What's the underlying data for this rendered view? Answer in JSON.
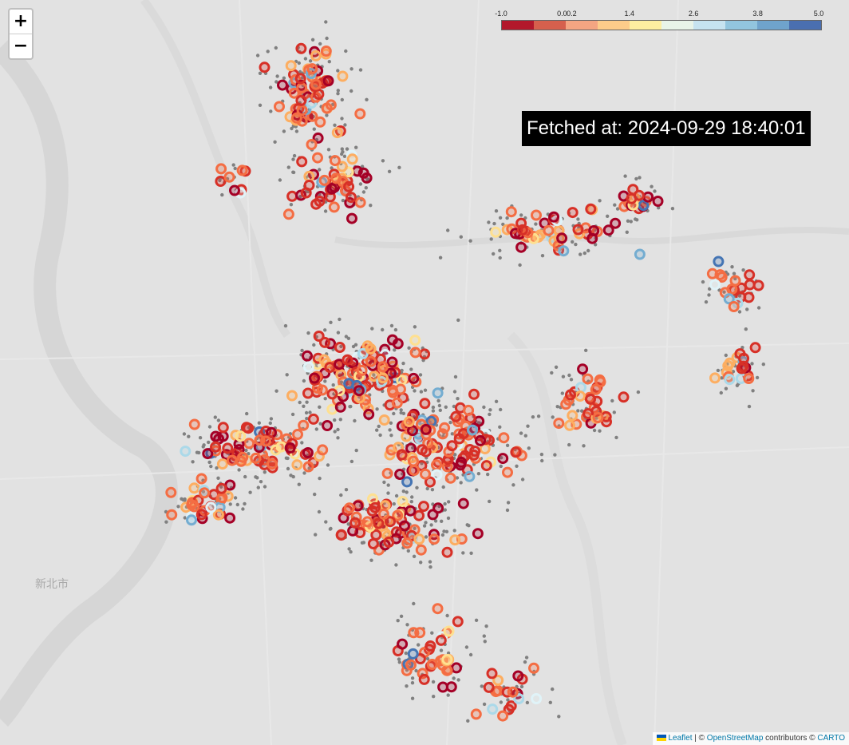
{
  "map": {
    "region_label": "新北市",
    "background_color": "#e2e2e2",
    "marker_palette": [
      "#a50026",
      "#d73027",
      "#f46d43",
      "#fdae61",
      "#fee090",
      "#e0f3f8",
      "#abd9e9",
      "#74add1",
      "#4575b4"
    ],
    "dot_color": "#808080"
  },
  "controls": {
    "zoom_in_label": "+",
    "zoom_out_label": "−"
  },
  "legend": {
    "ticks": [
      "-1.0",
      "0.0",
      "0.2",
      "1.4",
      "2.6",
      "3.8",
      "5.0"
    ],
    "colors": [
      "#b2182b",
      "#d6604d",
      "#f4a582",
      "#fdcc8a",
      "#fdeea0",
      "#e8f4e8",
      "#c6e3f0",
      "#92c5de",
      "#6fa3cc",
      "#4a6fb0"
    ]
  },
  "timestamp": {
    "text": "Fetched at: 2024-09-29 18:40:01"
  },
  "attribution": {
    "leaflet": "Leaflet",
    "separator": " | © ",
    "osm": "OpenStreetMap",
    "contributors": " contributors © ",
    "carto": "CARTO"
  }
}
